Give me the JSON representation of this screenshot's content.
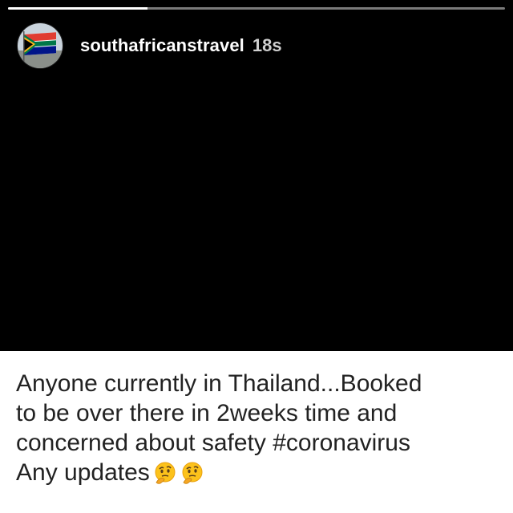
{
  "story": {
    "progress": 0.28,
    "username": "southafricanstravel",
    "time": "18s",
    "avatar_icon": "south-africa-flag-avatar-icon"
  },
  "caption": {
    "lines": [
      "Anyone currently in Thailand...Booked",
      "to be over there in 2weeks time and",
      "concerned about safety #coronavirus",
      "Any updates"
    ],
    "emojis": [
      "thinking-face-icon",
      "thinking-face-icon"
    ]
  },
  "colors": {
    "background": "#000000",
    "caption_background": "#ffffff",
    "caption_text": "#222222",
    "progress_track": "#7a7a7a",
    "progress_fill": "#ffffff"
  }
}
